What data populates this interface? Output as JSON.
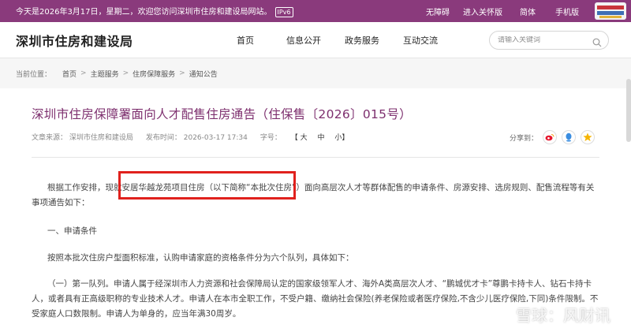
{
  "topbar": {
    "welcome": "今天是2026年3月17日，星期二，欢迎您访问深圳市住房和建设局网站。",
    "ipv6": "IPv6",
    "links": [
      "无障碍",
      "进入关怀版",
      "简体",
      "手机版"
    ]
  },
  "header": {
    "site_title": "深圳市住房和建设局",
    "nav": [
      "首页",
      "信息公开",
      "政务服务",
      "互动交流"
    ],
    "search_placeholder": "请输入关键词"
  },
  "breadcrumb": {
    "label": "当前位置：",
    "items": [
      "首页",
      "主题服务",
      "住房保障服务",
      "通知公告"
    ]
  },
  "article": {
    "title": "深圳市住房保障署面向人才配售住房通告（住保售〔2026〕015号）",
    "source": "文章来源：  深圳市住房和建设局",
    "time": "发布时间：  2026-03-17 17:34",
    "size_label": "字号：",
    "sizes": [
      "【 大",
      "中",
      "小】"
    ],
    "share_label": "分享到：",
    "paragraphs": [
      "根据工作安排，现就安居华越龙苑项目住房（以下简称“本批次住房”）面向高层次人才等群体配售的申请条件、房源安排、选房规则、配售流程等有关事项通告如下：",
      "一、申请条件",
      "按照本批次住房户型面积标准，认购申请家庭的资格条件分为六个队列，具体如下：",
      "（一）第一队列。申请人属于经深圳市人力资源和社会保障局认定的国家级领军人才、海外A类高层次人才、“鹏城优才卡”尊鹏卡持卡人、钻石卡持卡人，或者具有正高级职称的专业技术人才。申请人在本市全职工作，不受户籍、缴纳社会保险(养老保险或者医疗保险,不含少儿医疗保险,下同)条件限制。不受家庭人口数限制。申请人为单身的，应当年满30周岁。"
    ]
  },
  "watermark": "雪球：风财讯",
  "colors": {
    "brand": "#8a3a7c",
    "title": "#7d2f6e",
    "highlight": "#e0211d"
  }
}
